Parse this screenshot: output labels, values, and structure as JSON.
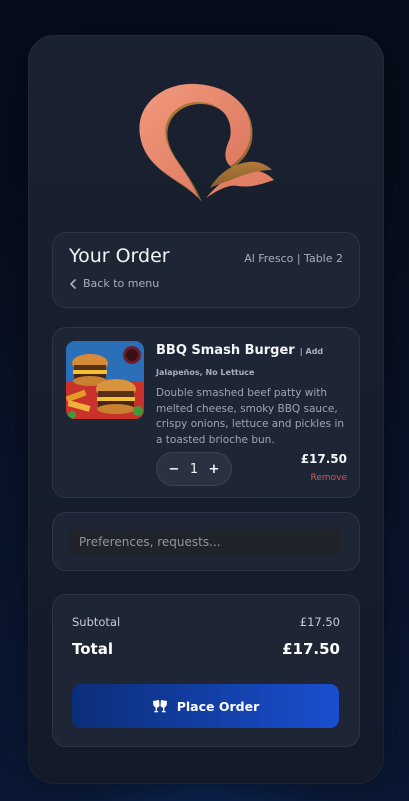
{
  "header": {
    "title": "Your Order",
    "venue": "Al Fresco | Table 2",
    "back_label": "Back to menu"
  },
  "item": {
    "name": "BBQ Smash Burger",
    "modifiers": "| Add Jalapeños, No Lettuce",
    "description": "Double smashed beef patty with melted cheese, smoky BBQ sauce, crispy onions, lettuce and pickles in a toasted brioche bun.",
    "quantity": "1",
    "decrement_label": "−",
    "increment_label": "+",
    "price": "£17.50",
    "remove_label": "Remove"
  },
  "notes": {
    "placeholder": "Preferences, requests..."
  },
  "summary": {
    "subtotal_label": "Subtotal",
    "subtotal_value": "£17.50",
    "total_label": "Total",
    "total_value": "£17.50",
    "place_order_label": "Place Order"
  },
  "icons": {
    "logo": "brand-logo-q",
    "back": "chevron-left-icon",
    "place_order": "cheers-icon"
  },
  "colors": {
    "accent_button_start": "#0b2e78",
    "accent_button_end": "#1a4fd0",
    "remove": "#d9534f",
    "logo": "#e8866a"
  }
}
